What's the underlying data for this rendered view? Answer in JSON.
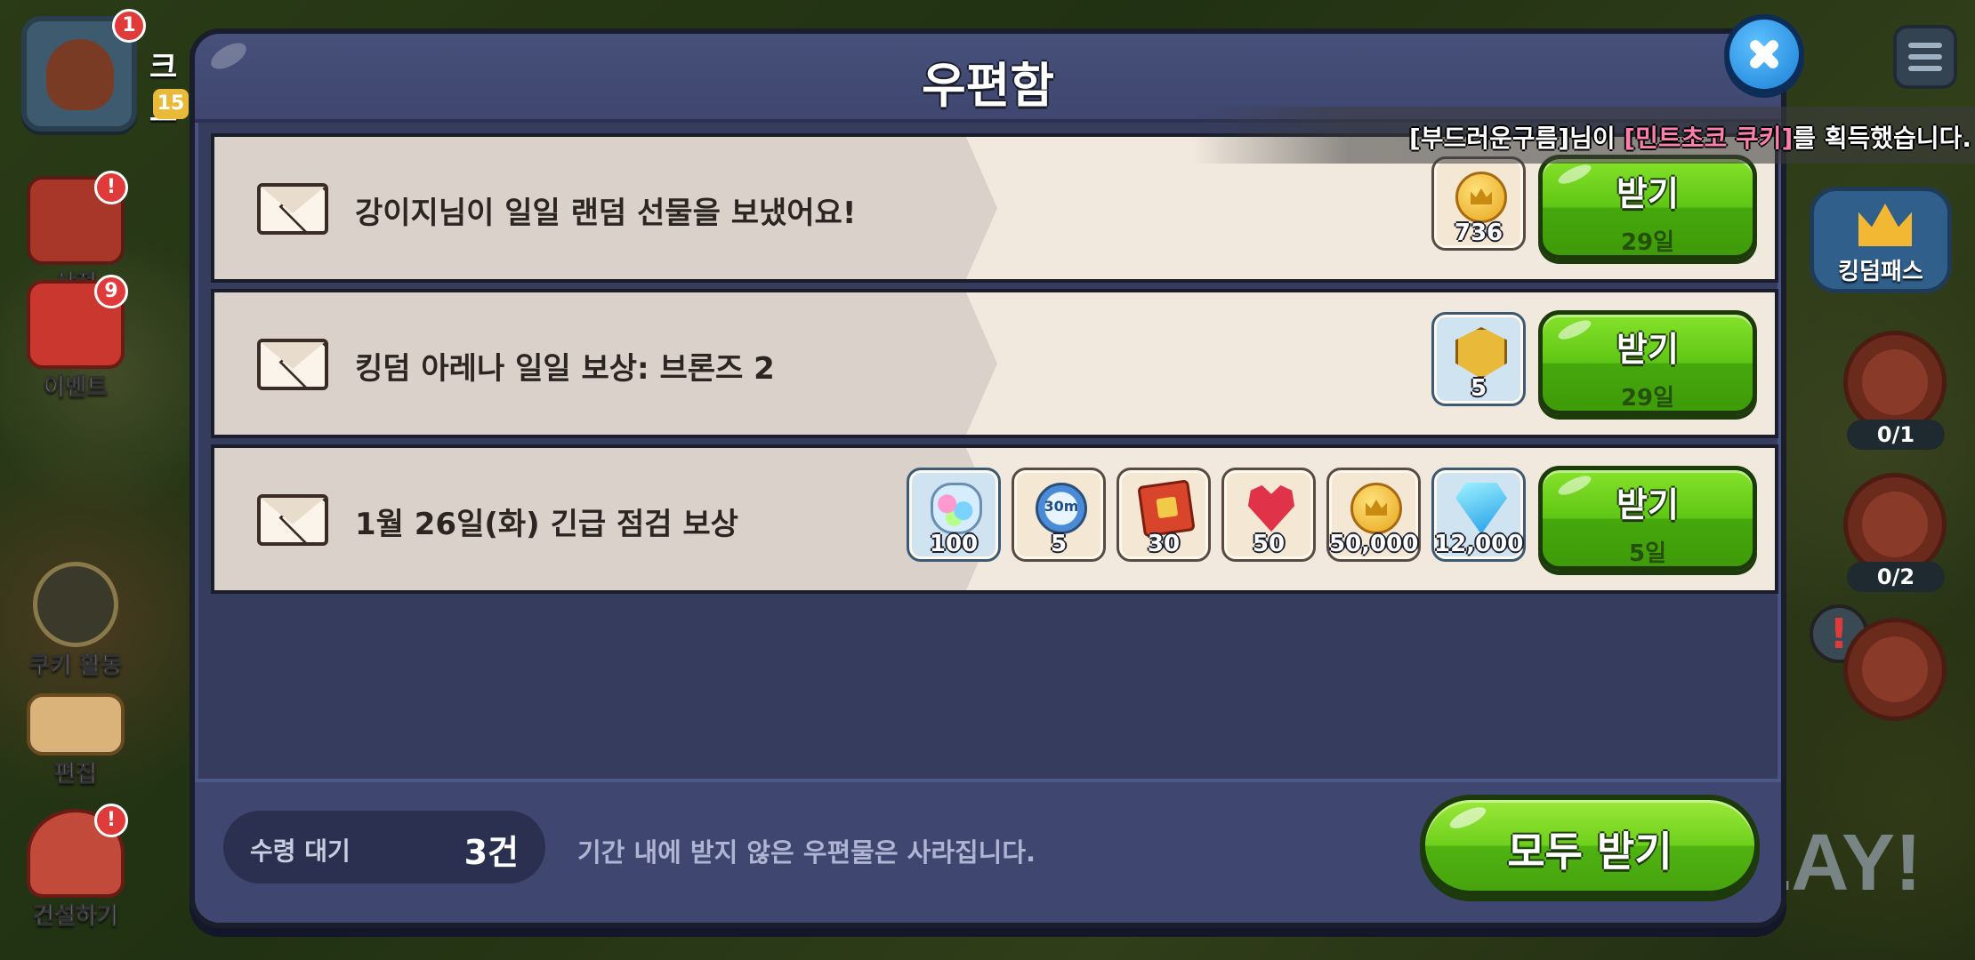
{
  "dialog": {
    "title": "우편함"
  },
  "ticker": {
    "prefix": "[부드러운구름]님이 ",
    "highlight": "[민트초코 쿠키]",
    "suffix": "를 획득했습니다."
  },
  "side_left": {
    "profile_badge": "1",
    "profile_name_partial": "크로",
    "profile_level_partial": "15",
    "shop_label": "상점",
    "event_label": "이벤트",
    "event_badge": "9",
    "cookie_activity_label": "쿠키 활동",
    "edit_label": "편집",
    "build_label": "건설하기",
    "shop_badge": "!",
    "build_badge": "!"
  },
  "side_right": {
    "kingdom_pass_label": "킹덤패스",
    "map_counter": "0/1",
    "stump_counter": "0/2",
    "alert": "!",
    "play_text": "LAY!"
  },
  "mails": [
    {
      "title": "강이지님이 일일 랜덤 선물을 보냈어요!",
      "claim_label": "받기",
      "days": "29일",
      "rewards": [
        {
          "icon": "coin-icon",
          "qty": "736",
          "style": "coin",
          "tone": "beige"
        }
      ]
    },
    {
      "title": "킹덤 아레나 일일 보상: 브론즈 2",
      "claim_label": "받기",
      "days": "29일",
      "rewards": [
        {
          "icon": "arena-medal-icon",
          "qty": "5",
          "style": "shield",
          "tone": "blue"
        }
      ]
    },
    {
      "title": "1월 26일(화) 긴급 점검 보상",
      "claim_label": "받기",
      "days": "5일",
      "rewards": [
        {
          "icon": "crystal-gem-icon",
          "qty": "12,000",
          "style": "gem",
          "tone": "blue"
        },
        {
          "icon": "coin-icon",
          "qty": "50,000",
          "style": "coin",
          "tone": "beige"
        },
        {
          "icon": "heart-jelly-icon",
          "qty": "50",
          "style": "heart",
          "tone": "beige"
        },
        {
          "icon": "ticket-book-icon",
          "qty": "30",
          "style": "book",
          "tone": "beige"
        },
        {
          "icon": "speedup-30m-icon",
          "qty": "5",
          "style": "clock",
          "tone": "beige",
          "icon_text": "30m"
        },
        {
          "icon": "candy-jar-icon",
          "qty": "100",
          "style": "candy",
          "tone": "blue"
        }
      ]
    }
  ],
  "footer": {
    "pending_label": "수령 대기",
    "pending_count": "3건",
    "note": "기간 내에 받지 않은 우편물은 사라집니다.",
    "claim_all_label": "모두 받기"
  },
  "colors": {
    "dialog_bg": "#353c5e",
    "row_bg": "#f2e9de",
    "claim_green": "#5fc615",
    "close_blue": "#1b7fd6",
    "ticker_highlight": "#ff7eb0"
  }
}
